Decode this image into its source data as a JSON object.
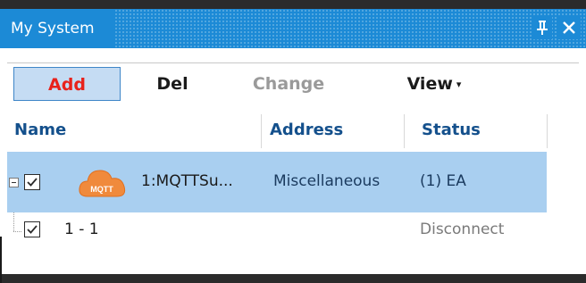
{
  "panel": {
    "title": "My System",
    "pin_glyph": "Ͱ",
    "close_glyph": "✕"
  },
  "toolbar": {
    "add_label": "Add",
    "del_label": "Del",
    "change_label": "Change",
    "view_label": "View",
    "view_caret": "▾"
  },
  "columns": {
    "name": "Name",
    "address": "Address",
    "status": "Status"
  },
  "rows": [
    {
      "icon": "mqtt-cloud-icon",
      "icon_text": "MQTT",
      "name": "1:MQTTSu...",
      "address": "Miscellaneous",
      "status": "(1) EA",
      "checked": true,
      "expanded": true,
      "selected": true
    },
    {
      "name": "1 - 1",
      "address": "",
      "status": "Disconnect",
      "checked": true,
      "selected": false
    }
  ],
  "colors": {
    "titlebar": "#1c8ad6",
    "selection": "#a9cff0",
    "header_text": "#14508c",
    "add_text": "#e8221c",
    "mqtt_orange": "#f08a3c"
  }
}
